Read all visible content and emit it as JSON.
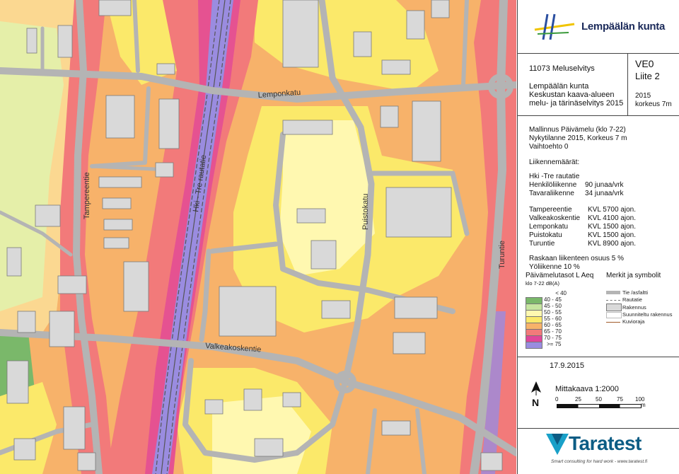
{
  "map": {
    "streets": {
      "lemponkatu": "Lemponkatu",
      "tampereentie": "Tampereentie",
      "rautatie": "Hki - Tre rautatie",
      "puistokatu": "Puistokatu",
      "turuntie": "Turuntie",
      "valkeakoskentie": "Valkeakoskentie"
    }
  },
  "panel": {
    "brand": "Lempäälän kunta",
    "project_no": "11073 Meluselvitys",
    "client": "Lempäälän kunta",
    "project_line1": "Keskustan kaava-alueen",
    "project_line2": "melu- ja tärinäselvitys 2015",
    "ve": "VE0",
    "liite": "Liite 2",
    "year": "2015",
    "height": "korkeus 7m",
    "model_line1": "Mallinnus Päivämelu (klo 7-22)",
    "model_line2": "Nykytilanne 2015, Korkeus 7 m",
    "model_line3": "Vaihtoehto 0",
    "traffic_title": "Liikennemäärät:",
    "rail_title": "Hki -Tre rautatie",
    "rail": [
      {
        "name": "Henkilöliikenne",
        "value": "90 junaa/vrk"
      },
      {
        "name": "Tavaraliikenne",
        "value": "34 junaa/vrk"
      }
    ],
    "roads": [
      {
        "name": "Tampereentie",
        "value": "KVL 5700 ajon."
      },
      {
        "name": "Valkeakoskentie",
        "value": "KVL 4100 ajon."
      },
      {
        "name": "Lemponkatu",
        "value": "KVL 1500 ajon."
      },
      {
        "name": "Puistokatu",
        "value": "KVL 1500 ajon."
      },
      {
        "name": "Turuntie",
        "value": "KVL 8900 ajon."
      }
    ],
    "heavy": "Raskaan liikenteen osuus 5 %",
    "night": "Yöliikenne 10 %",
    "legend_title": "Päivämelutasot L Aeq",
    "legend_sub": "klo 7-22 dB(A)",
    "levels": [
      {
        "label": "<  40",
        "color": null
      },
      {
        "label": "40  -  45",
        "color": "#7ab86a"
      },
      {
        "label": "45  -  50",
        "color": "#c6e5a0"
      },
      {
        "label": "50  -  55",
        "color": "#fff8b0"
      },
      {
        "label": "55  -  60",
        "color": "#fbe96a"
      },
      {
        "label": "60  -  65",
        "color": "#f7b26a"
      },
      {
        "label": "65  -  70",
        "color": "#f27a7a"
      },
      {
        "label": "70  -  75",
        "color": "#e0469a"
      },
      {
        "label": ">=  75",
        "color": "#9a8ce0"
      }
    ],
    "symbols_title": "Merkit ja symbolit",
    "symbols": [
      "Tie /asfaltti",
      "Rautatie",
      "Rakennus",
      "Suunniteltu rakennus",
      "Kuvioraja"
    ],
    "date": "17.9.2015",
    "scale": "Mittakaava 1:2000",
    "scale_ticks": [
      "0",
      "25",
      "50",
      "75",
      "100"
    ],
    "scale_unit": "m",
    "north": "N",
    "tara_logo": "Taratest",
    "tara_tagline": "Smart consulting for hard work - www.taratest.fi",
    "colors": {
      "road": "#b4b4b4",
      "building": "#d9d9d9",
      "rail": "#9a8ce0",
      "red": "#f27a7a",
      "orange": "#f7b26a",
      "yellow": "#fbe96a",
      "lightyellow": "#fff8b0",
      "green": "#c6e5a0",
      "pink": "#e0469a"
    }
  }
}
